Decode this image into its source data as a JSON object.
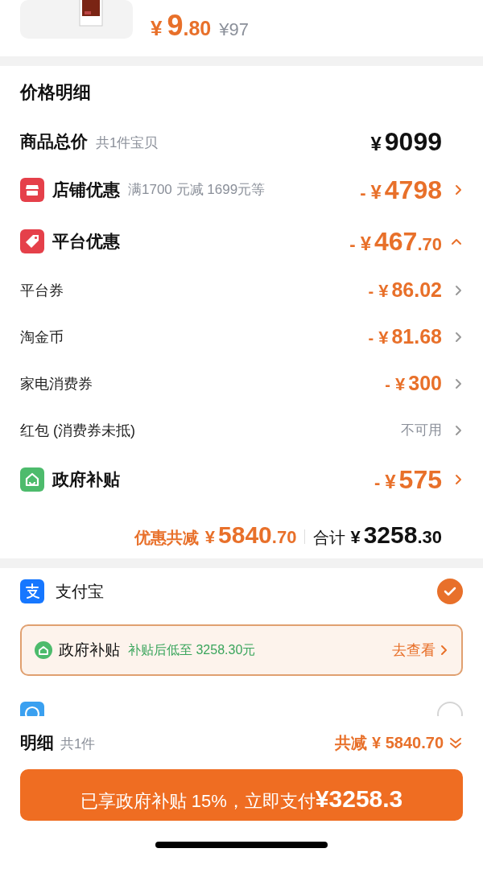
{
  "product": {
    "kind": "picture",
    "price_currency": "¥",
    "price_main": "9",
    "price_decimal": ".80",
    "original_price": "¥97"
  },
  "price_detail": {
    "title": "价格明细",
    "total": {
      "label": "商品总价",
      "note": "共1件宝贝",
      "currency": "¥",
      "amount": "9099"
    },
    "rows": [
      {
        "kind": "main",
        "label": "店铺优惠",
        "note": "满1700 元减 1699元等",
        "minus": "-",
        "currency": "¥",
        "amount_main": "4798",
        "amount_decimal": "",
        "expanded": false
      },
      {
        "kind": "main",
        "label": "平台优惠",
        "minus": "-",
        "currency": "¥",
        "amount_main": "467",
        "amount_decimal": ".70",
        "expanded": true
      },
      {
        "kind": "sub",
        "label": "平台券",
        "minus": "-",
        "currency": "¥",
        "amount_main": "86.02"
      },
      {
        "kind": "sub",
        "label": "淘金币",
        "minus": "-",
        "currency": "¥",
        "amount_main": "81.68"
      },
      {
        "kind": "sub",
        "label": "家电消费券",
        "minus": "-",
        "currency": "¥",
        "amount_main": "300"
      },
      {
        "kind": "sub",
        "label": "红包 (消费券未抵)",
        "status": "不可用"
      },
      {
        "kind": "main",
        "label": "政府补贴",
        "minus": "-",
        "currency": "¥",
        "amount_main": "575",
        "amount_decimal": "",
        "expanded": false
      }
    ],
    "summary": {
      "discount_label": "优惠共减",
      "discount_currency": "¥",
      "discount_main": "5840",
      "discount_decimal": ".70",
      "total_label": "合计",
      "total_currency": "¥",
      "total_main": "3258",
      "total_decimal": ".30"
    }
  },
  "payment": {
    "methods": [
      {
        "label": "支付宝",
        "selected": true
      },
      {
        "selected": false
      }
    ],
    "subsidy_banner": {
      "label": "政府补贴",
      "note": "补贴后低至 3258.30元",
      "link": "去查看"
    }
  },
  "footer": {
    "label": "明细",
    "count": "共1件",
    "discount": "共减 ¥ 5840.70",
    "button_text": "已享政府补贴 15%，立即支付",
    "button_amount": "¥3258.3"
  }
}
